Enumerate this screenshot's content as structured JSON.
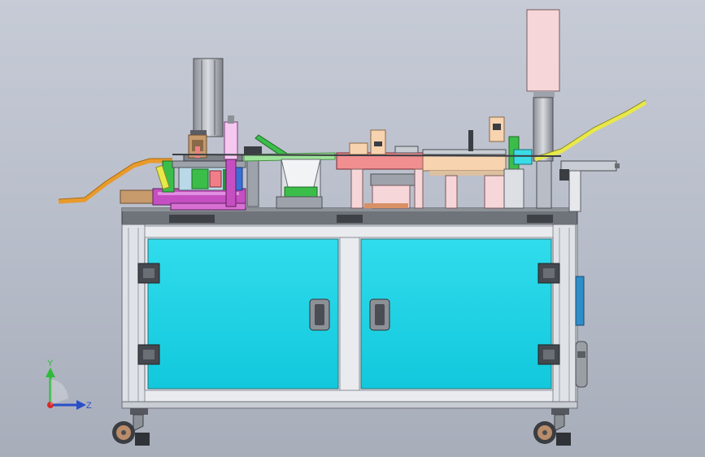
{
  "viewport": {
    "background_top": "#c6cbd6",
    "background_bottom": "#a8adba"
  },
  "colors": {
    "cabinet_panel": "#1ad4e6",
    "frame": "#e6e8ec",
    "frame_shade": "#b9bdc6",
    "table_top": "#6f737a",
    "magenta": "#c54fc2",
    "orange_chute": "#e89a2c",
    "yellow_chute": "#e8e84a",
    "pink": "#f07e88",
    "peach": "#f7d3b0",
    "light_pink": "#f6d6d8",
    "green": "#3bbd4a",
    "tan": "#c79a6c",
    "dark": "#3a3d42"
  },
  "axis_triad": {
    "y_label": "Y",
    "z_label": "Z",
    "y_color": "#2dbb3a",
    "z_color": "#2a4ec8",
    "x_color": "#d42a2a"
  }
}
